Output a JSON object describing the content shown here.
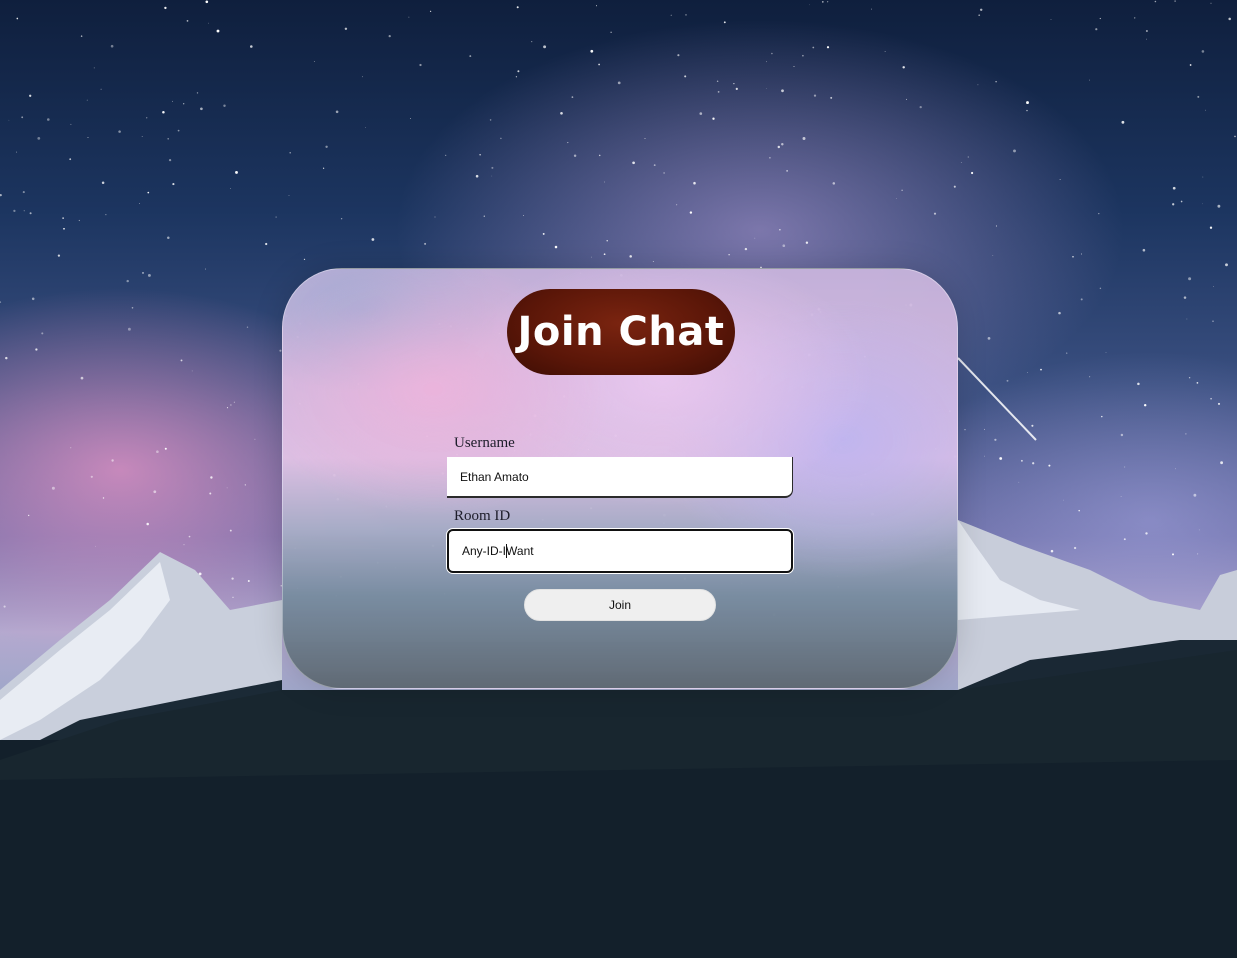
{
  "header": {
    "title": "Join Chat"
  },
  "form": {
    "username_label": "Username",
    "username_value": "Ethan Amato",
    "room_label": "Room ID",
    "room_value_before_caret": "Any-ID-I",
    "room_value_after_caret": "Want",
    "join_label": "Join"
  },
  "theme": {
    "title_pill_color": "#5a1608",
    "card_color": "#d8c2e6"
  },
  "background": {
    "icon": "night-sky-mountains-image"
  }
}
